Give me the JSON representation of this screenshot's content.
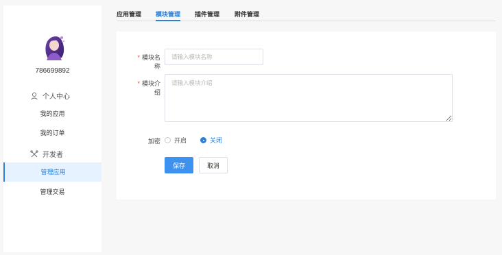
{
  "sidebar": {
    "user_id": "786699892",
    "groups": [
      {
        "title": "个人中心",
        "icon": "user-icon"
      },
      {
        "title": "开发者",
        "icon": "developer-icon"
      }
    ],
    "items": [
      {
        "label": "我的应用"
      },
      {
        "label": "我的订单"
      },
      {
        "label": "管理应用",
        "active": true
      },
      {
        "label": "管理交易"
      }
    ]
  },
  "tabs": [
    {
      "label": "应用管理"
    },
    {
      "label": "模块管理",
      "active": true
    },
    {
      "label": "插件管理"
    },
    {
      "label": "附件管理"
    }
  ],
  "form": {
    "name_label": "模块名称",
    "name_placeholder": "请输入模块名称",
    "desc_label": "模块介绍",
    "desc_placeholder": "请输入模块介绍",
    "encrypt_label": "加密",
    "encrypt_options": [
      {
        "label": "开启",
        "checked": false
      },
      {
        "label": "关闭",
        "checked": true
      }
    ],
    "required_mark": "*",
    "save_label": "保存",
    "cancel_label": "取消"
  },
  "colors": {
    "accent": "#2b7fd6",
    "primary_button": "#3d92f0",
    "required": "#e74c3c"
  }
}
